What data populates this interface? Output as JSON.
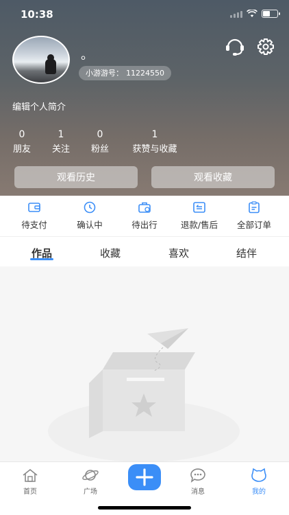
{
  "status_bar": {
    "time": "10:38"
  },
  "profile": {
    "nickname": "。",
    "uid_label": "小游游号：",
    "uid_value": "11224550",
    "intro_placeholder": "编辑个人简介"
  },
  "stats": [
    {
      "count": "0",
      "label": "朋友"
    },
    {
      "count": "1",
      "label": "关注"
    },
    {
      "count": "0",
      "label": "粉丝"
    },
    {
      "count": "1",
      "label": "获赞与收藏"
    }
  ],
  "header_buttons": {
    "history": "观看历史",
    "favorites": "观看收藏"
  },
  "orders": [
    {
      "label": "待支付",
      "icon": "wallet-icon"
    },
    {
      "label": "确认中",
      "icon": "clock-icon"
    },
    {
      "label": "待出行",
      "icon": "suitcase-icon"
    },
    {
      "label": "退款/售后",
      "icon": "refund-icon"
    },
    {
      "label": "全部订单",
      "icon": "clipboard-icon"
    }
  ],
  "tabs": [
    {
      "label": "作品",
      "active": true
    },
    {
      "label": "收藏"
    },
    {
      "label": "喜欢"
    },
    {
      "label": "结伴"
    }
  ],
  "tabbar": [
    {
      "label": "首页",
      "icon": "home-icon"
    },
    {
      "label": "广场",
      "icon": "planet-icon"
    },
    {
      "label": "消息",
      "icon": "chat-icon"
    },
    {
      "label": "我的",
      "icon": "cat-face-icon",
      "active": true
    }
  ],
  "colors": {
    "accent": "#3b8ef7"
  }
}
